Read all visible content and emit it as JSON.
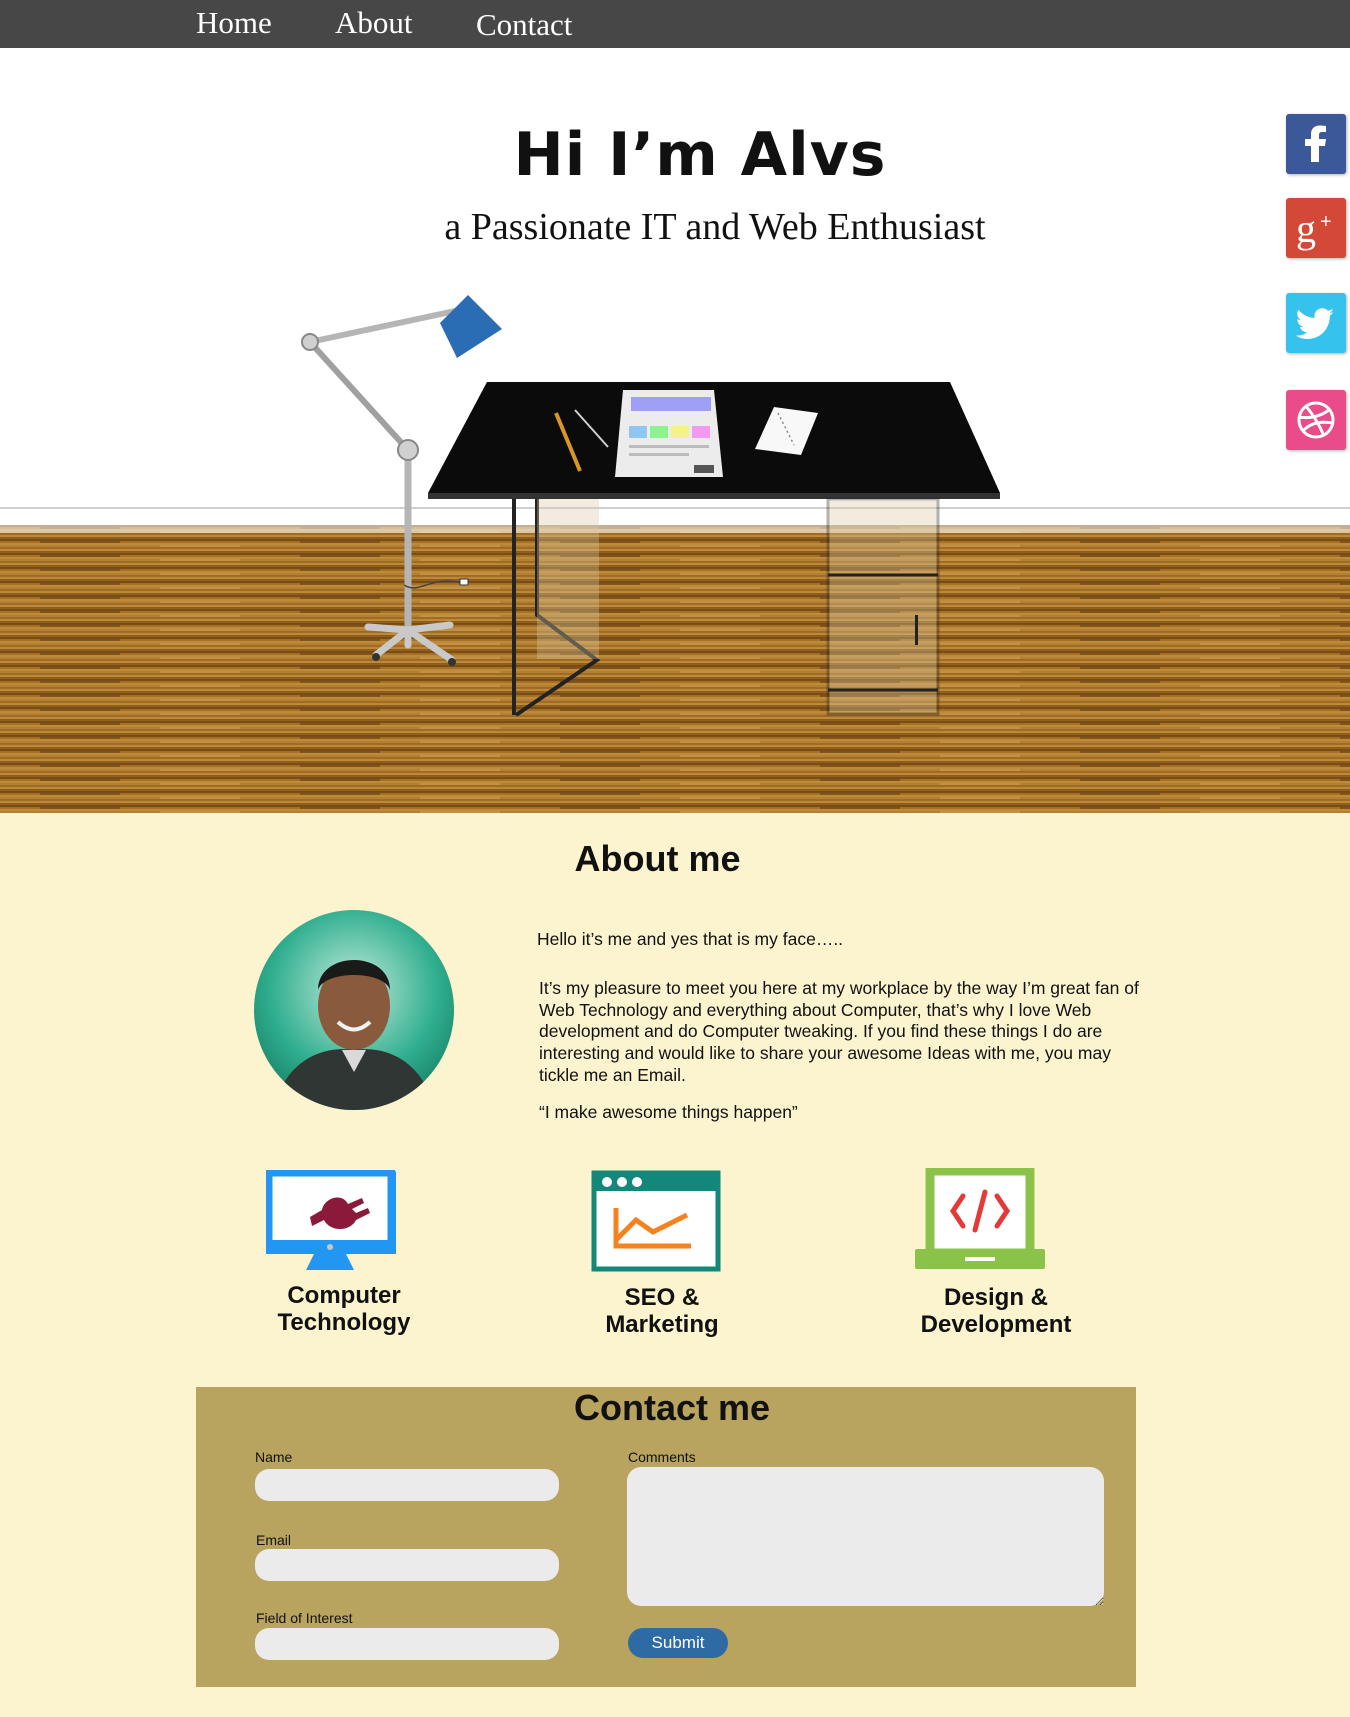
{
  "nav": {
    "items": [
      "Home",
      "About",
      "Contact"
    ]
  },
  "social": [
    "facebook",
    "google-plus",
    "twitter",
    "dribbble"
  ],
  "hero": {
    "title": "Hi I’m Alvs",
    "subtitle": "a Passionate IT and Web Enthusiast"
  },
  "about": {
    "title": "About me",
    "greeting": "Hello it’s me and yes that is my face…..",
    "body": "It’s my pleasure to meet you here at my workplace by the way I’m great fan of Web Technology and everything about Computer, that’s why I love Web development and do Computer tweaking. If you find these things I do are interesting and would like to share your awesome Ideas with me, you may tickle me an Email.",
    "quote": "“I make awesome things happen”"
  },
  "skills": [
    {
      "icon": "monitor-plug-icon",
      "line1": "Computer",
      "line2": "Technology"
    },
    {
      "icon": "browser-chart-icon",
      "line1": "SEO &",
      "line2": "Marketing"
    },
    {
      "icon": "laptop-code-icon",
      "line1": "Design &",
      "line2": "Development"
    }
  ],
  "contact": {
    "title": "Contact me",
    "name_label": "Name",
    "email_label": "Email",
    "interest_label": "Field of Interest",
    "comments_label": "Comments",
    "submit": "Submit"
  },
  "colors": {
    "nav": "#474747",
    "about_bg": "#fcf3cf",
    "contact_bg": "#b8a35f",
    "submit": "#2e6ba5"
  }
}
